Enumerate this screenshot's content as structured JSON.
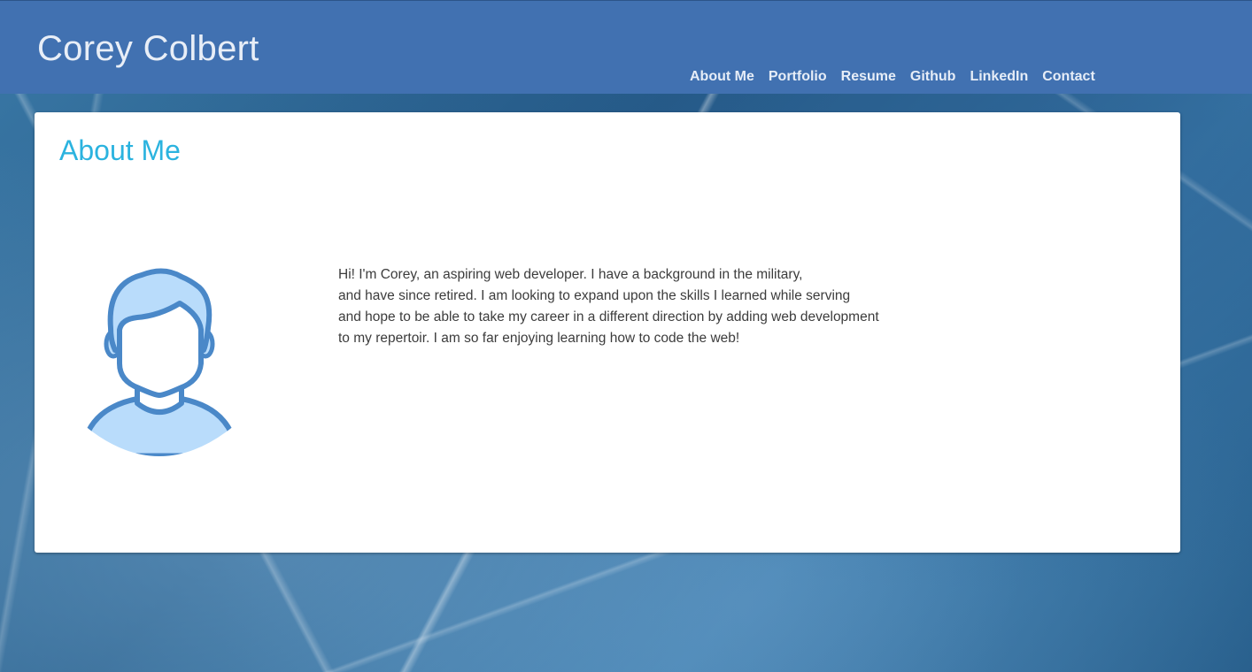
{
  "header": {
    "site_title": "Corey Colbert",
    "nav": [
      {
        "label": "About Me"
      },
      {
        "label": "Portfolio"
      },
      {
        "label": "Resume"
      },
      {
        "label": "Github"
      },
      {
        "label": "LinkedIn"
      },
      {
        "label": "Contact"
      }
    ]
  },
  "about": {
    "heading": "About Me",
    "avatar_icon": "user-avatar-icon",
    "bio_lines": [
      "Hi! I'm Corey, an aspiring web developer. I have a background in the military,",
      "and have since retired. I am looking to expand upon the skills I learned while serving",
      "and hope to be able to take my career in a different direction by adding web development",
      "to my repertoir. I am so far enjoying learning how to code the web!"
    ]
  },
  "colors": {
    "header_bg": "#4171b1",
    "heading_accent": "#2bb3df",
    "avatar_stroke": "#4a88c8",
    "avatar_fill": "#b9dcfb"
  }
}
